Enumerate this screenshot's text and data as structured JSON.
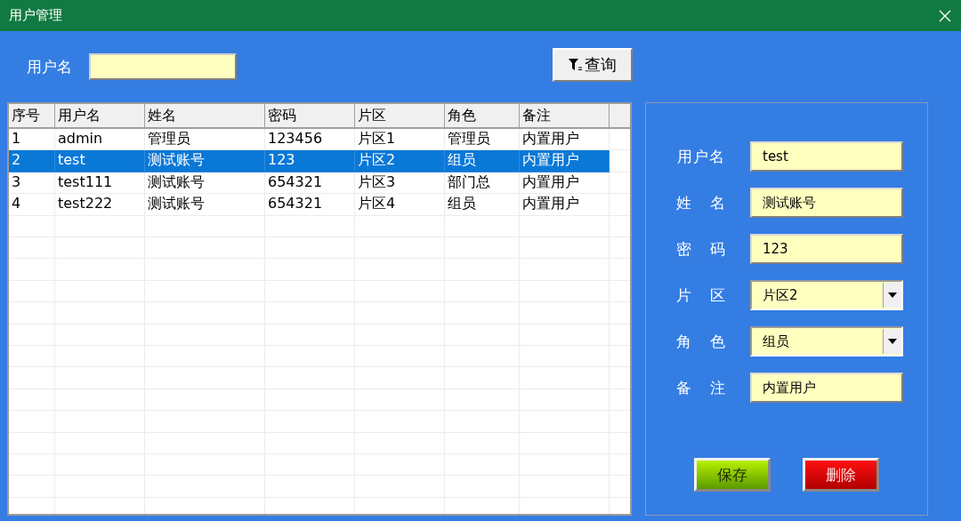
{
  "window": {
    "title": "用户管理"
  },
  "search": {
    "label": "用户名",
    "button": "查询"
  },
  "table": {
    "columns": [
      "序号",
      "用户名",
      "姓名",
      "密码",
      "片区",
      "角色",
      "备注"
    ],
    "rows": [
      {
        "cells": [
          "1",
          "admin",
          "管理员",
          "123456",
          "片区1",
          "管理员",
          "内置用户"
        ],
        "selected": false
      },
      {
        "cells": [
          "2",
          "test",
          "测试账号",
          "123",
          "片区2",
          "组员",
          "内置用户"
        ],
        "selected": true
      },
      {
        "cells": [
          "3",
          "test111",
          "测试账号",
          "654321",
          "片区3",
          "部门总",
          "内置用户"
        ],
        "selected": false
      },
      {
        "cells": [
          "4",
          "test222",
          "测试账号",
          "654321",
          "片区4",
          "组员",
          "内置用户"
        ],
        "selected": false
      }
    ]
  },
  "form": {
    "fields": [
      {
        "label": "用户名",
        "value": "test",
        "kind": "text"
      },
      {
        "label": "姓 名",
        "value": "测试账号",
        "kind": "text"
      },
      {
        "label": "密 码",
        "value": "123",
        "kind": "text"
      },
      {
        "label": "片 区",
        "value": "片区2",
        "kind": "select"
      },
      {
        "label": "角 色",
        "value": "组员",
        "kind": "select"
      },
      {
        "label": "备 注",
        "value": "内置用户",
        "kind": "text"
      }
    ],
    "buttons": [
      {
        "label": "保存",
        "kind": "save"
      },
      {
        "label": "删除",
        "kind": "delete"
      }
    ]
  }
}
